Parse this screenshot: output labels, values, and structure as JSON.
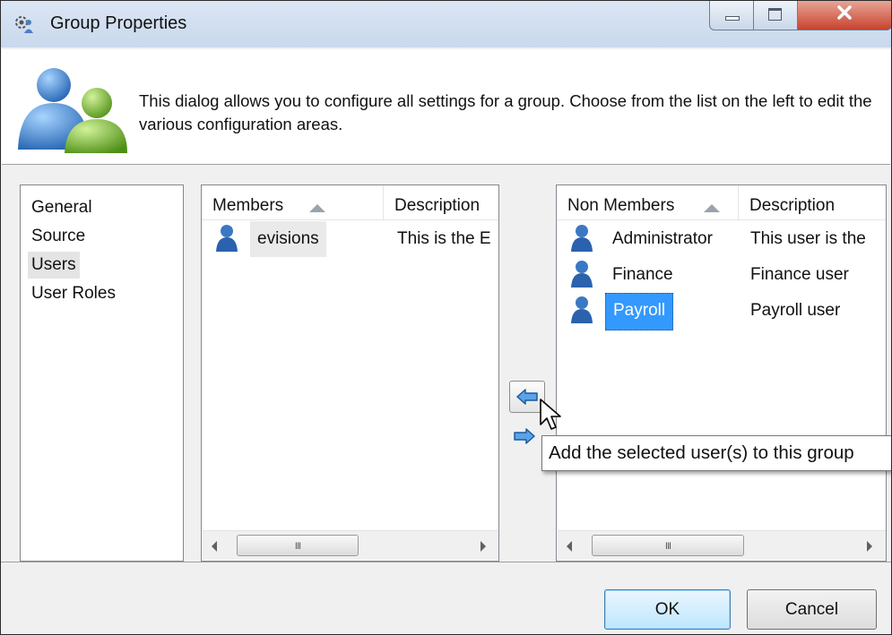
{
  "window": {
    "title": "Group Properties"
  },
  "header": {
    "icon": "users-group-icon",
    "description": "This dialog allows you to configure all settings for a group.  Choose from the list on the left to edit the various configuration areas."
  },
  "nav": {
    "items": [
      {
        "label": "General"
      },
      {
        "label": "Source"
      },
      {
        "label": "Users",
        "selected": true
      },
      {
        "label": "User Roles"
      }
    ]
  },
  "members": {
    "columns": {
      "name": "Members",
      "description": "Description"
    },
    "rows": [
      {
        "name": "evisions",
        "description": "This is the E"
      }
    ]
  },
  "non_members": {
    "columns": {
      "name": "Non Members",
      "description": "Description"
    },
    "rows": [
      {
        "name": "Administrator",
        "description": "This user is the"
      },
      {
        "name": "Finance",
        "description": "Finance user"
      },
      {
        "name": "Payroll",
        "description": "Payroll user",
        "selected": true
      }
    ]
  },
  "tooltip": {
    "text": "Add the selected user(s) to this group"
  },
  "scrollbar": {
    "grip": "III"
  },
  "buttons": {
    "ok": "OK",
    "cancel": "Cancel"
  },
  "colors": {
    "selection": "#3399ff",
    "title_bar": "#c9d8ec",
    "close_button": "#c7432f"
  }
}
